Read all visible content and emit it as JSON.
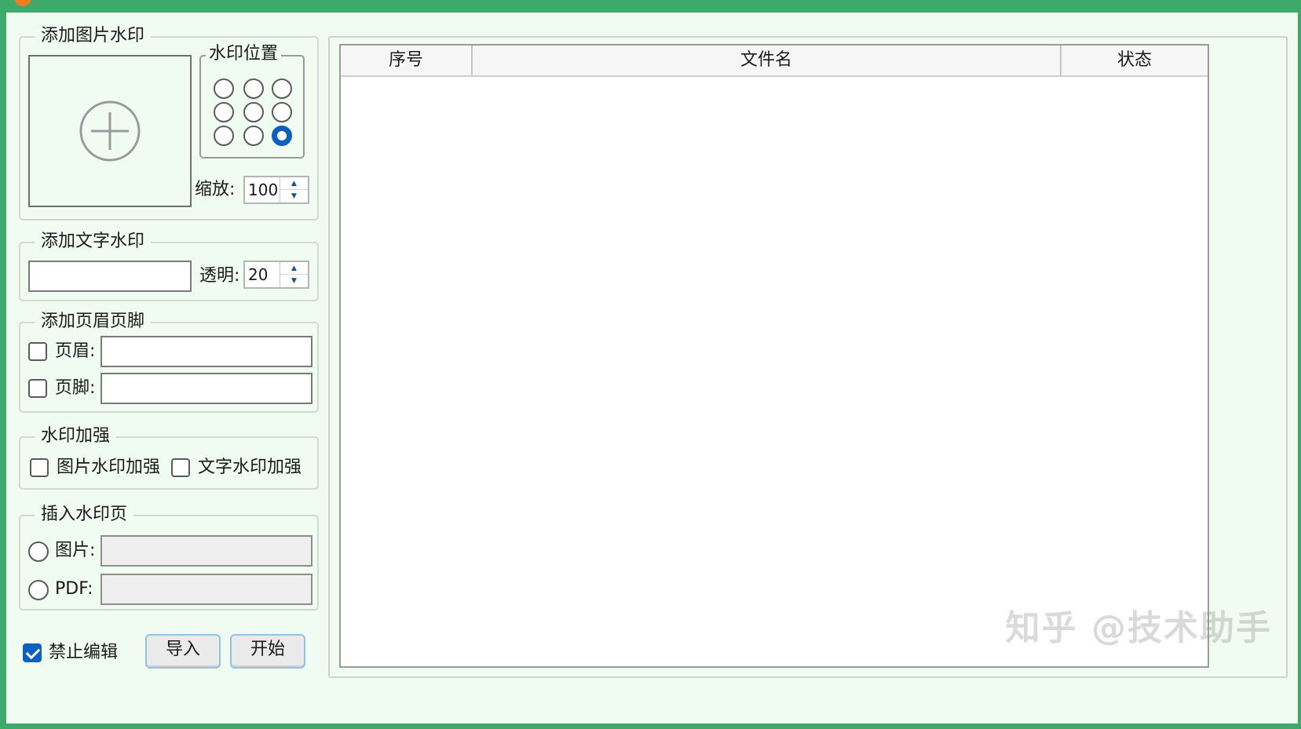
{
  "groups": {
    "image_watermark": {
      "title": "添加图片水印",
      "position_title": "水印位置",
      "positions_selected": 8,
      "scale_label": "缩放:",
      "scale_value": "100"
    },
    "text_watermark": {
      "title": "添加文字水印",
      "text_value": "",
      "opacity_label": "透明:",
      "opacity_value": "20"
    },
    "header_footer": {
      "title": "添加页眉页脚",
      "header_label": "页眉:",
      "header_checked": false,
      "header_value": "",
      "footer_label": "页脚:",
      "footer_checked": false,
      "footer_value": ""
    },
    "enhance": {
      "title": "水印加强",
      "image_label": "图片水印加强",
      "image_checked": false,
      "text_label": "文字水印加强",
      "text_checked": false
    },
    "insert_page": {
      "title": "插入水印页",
      "image_label": "图片:",
      "pdf_label": "PDF:"
    }
  },
  "bottom": {
    "disable_edit_label": "禁止编辑",
    "disable_edit_checked": true,
    "import_label": "导入",
    "start_label": "开始"
  },
  "table": {
    "columns": [
      "序号",
      "文件名",
      "状态"
    ],
    "rows": []
  },
  "watermark_text": "知乎 @技术助手",
  "colors": {
    "title_bar": "#3daa6c",
    "accent": "#0f5fbf",
    "background": "#f0fbf1"
  }
}
